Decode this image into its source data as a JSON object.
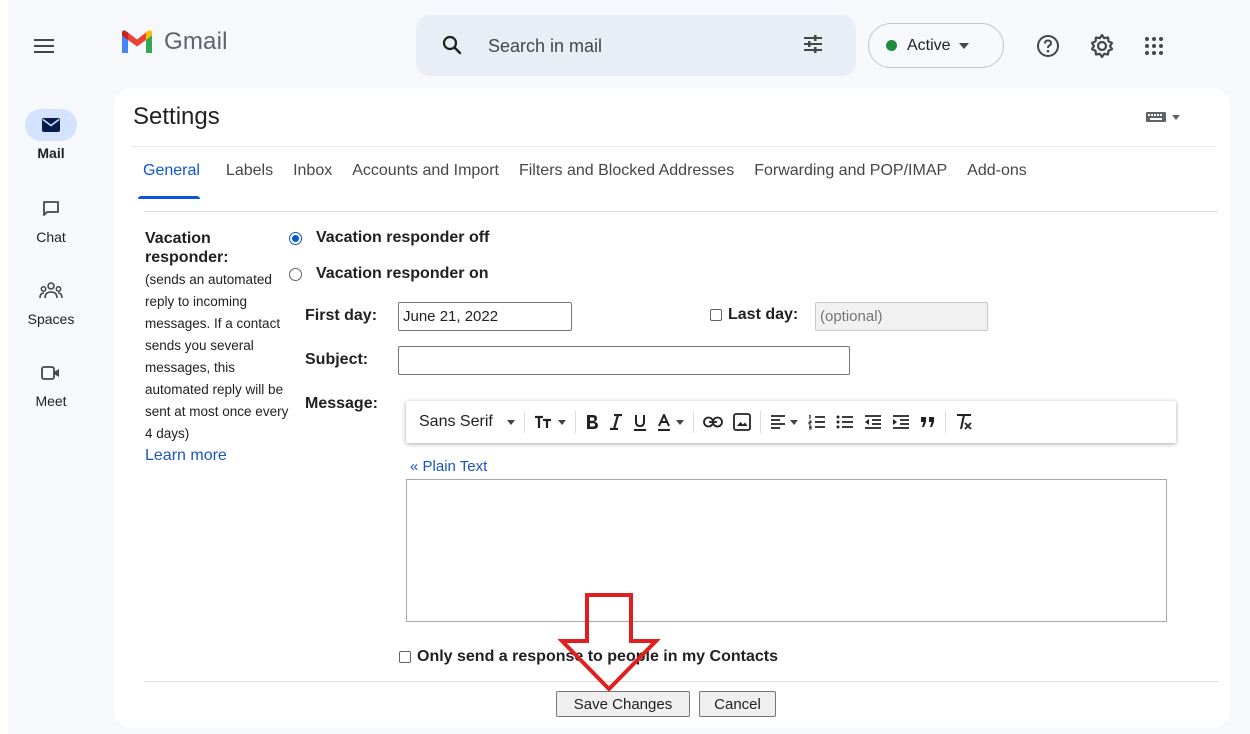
{
  "app": {
    "name": "Gmail"
  },
  "colors": {
    "accent": "#0b57d0",
    "active_status": "#1e8e3e",
    "arrow": "#e02020",
    "link": "#1a56c4"
  },
  "rail": {
    "items": [
      {
        "label": "Mail",
        "icon": "mail-icon",
        "active": true
      },
      {
        "label": "Chat",
        "icon": "chat-icon",
        "active": false
      },
      {
        "label": "Spaces",
        "icon": "spaces-icon",
        "active": false
      },
      {
        "label": "Meet",
        "icon": "meet-icon",
        "active": false
      }
    ]
  },
  "search": {
    "placeholder": "Search in mail"
  },
  "status": {
    "label": "Active"
  },
  "page": {
    "title": "Settings"
  },
  "tabs": [
    {
      "label": "General",
      "active": true
    },
    {
      "label": "Labels"
    },
    {
      "label": "Inbox"
    },
    {
      "label": "Accounts and Import"
    },
    {
      "label": "Filters and Blocked Addresses"
    },
    {
      "label": "Forwarding and POP/IMAP"
    },
    {
      "label": "Add-ons"
    }
  ],
  "vacation": {
    "title": "Vacation responder:",
    "description": "(sends an automated reply to incoming messages. If a contact sends you several messages, this automated reply will be sent at most once every 4 days)",
    "learn_more": "Learn more",
    "off_label": "Vacation responder off",
    "on_label": "Vacation responder on",
    "selected": "off",
    "first_day_label": "First day:",
    "first_day_value": "June 21, 2022",
    "last_day_label": "Last day:",
    "last_day_placeholder": "(optional)",
    "subject_label": "Subject:",
    "subject_value": "",
    "message_label": "Message:",
    "font_name": "Sans Serif",
    "plain_text_link": "« Plain Text",
    "message_value": "",
    "contacts_only_label": "Only send a response to people in my Contacts"
  },
  "buttons": {
    "save": "Save Changes",
    "cancel": "Cancel"
  }
}
